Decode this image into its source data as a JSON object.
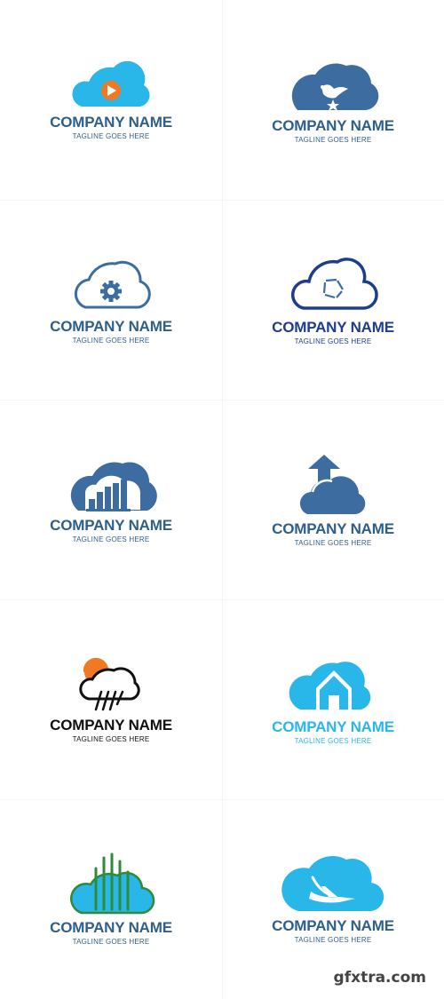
{
  "logos": [
    {
      "company": "COMPANY NAME",
      "tagline": "TAGLINE GOES HERE",
      "icon": "cloud-play-icon",
      "text_color": "#2e5f8a"
    },
    {
      "company": "COMPANY NAME",
      "tagline": "TAGLINE GOES HERE",
      "icon": "cloud-bird-icon",
      "text_color": "#2e5f8a"
    },
    {
      "company": "COMPANY NAME",
      "tagline": "TAGLINE GOES HERE",
      "icon": "cloud-gear-icon",
      "text_color": "#2e5f8a"
    },
    {
      "company": "COMPANY NAME",
      "tagline": "TAGLINE GOES HERE",
      "icon": "cloud-aperture-icon",
      "text_color": "#1d3d8f"
    },
    {
      "company": "COMPANY NAME",
      "tagline": "TAGLINE GOES HERE",
      "icon": "cloud-bar-chart-icon",
      "text_color": "#2e5f8a"
    },
    {
      "company": "COMPANY NAME",
      "tagline": "TAGLINE GOES HERE",
      "icon": "cloud-upload-arrow-icon",
      "text_color": "#2e5f8a"
    },
    {
      "company": "COMPANY NAME",
      "tagline": "TAGLINE GOES HERE",
      "icon": "cloud-rain-sun-icon",
      "text_color": "#111111"
    },
    {
      "company": "COMPANY NAME",
      "tagline": "TAGLINE GOES HERE",
      "icon": "cloud-house-icon",
      "text_color": "#29b6e8"
    },
    {
      "company": "COMPANY NAME",
      "tagline": "TAGLINE GOES HERE",
      "icon": "cloud-city-icon",
      "text_color": "#2e5f8a"
    },
    {
      "company": "COMPANY NAME",
      "tagline": "TAGLINE GOES HERE",
      "icon": "cloud-airplane-icon",
      "text_color": "#2e5f8a"
    }
  ],
  "colors": {
    "steel_blue": "#3d6da0",
    "navy": "#1d3d8f",
    "sky": "#29b6e8",
    "orange": "#f07a22",
    "green": "#2e8b3a",
    "black": "#111111"
  },
  "watermark": "gfxtra.com"
}
